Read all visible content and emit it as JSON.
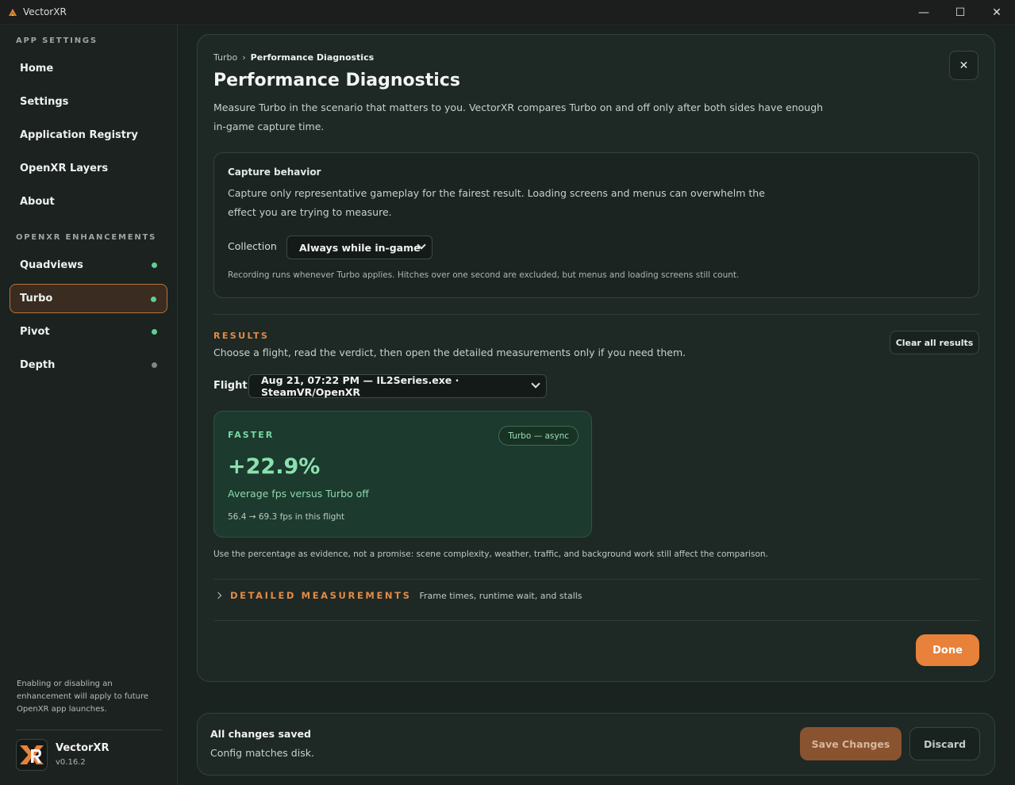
{
  "window": {
    "title": "VectorXR",
    "minimize_glyph": "—",
    "maximize_glyph": "☐",
    "close_glyph": "✕"
  },
  "sidebar": {
    "app_settings_label": "APP SETTINGS",
    "app_items": [
      {
        "label": "Home"
      },
      {
        "label": "Settings"
      },
      {
        "label": "Application Registry"
      },
      {
        "label": "OpenXR Layers"
      },
      {
        "label": "About"
      }
    ],
    "enhancements_label": "OPENXR ENHANCEMENTS",
    "enhancement_items": [
      {
        "label": "Quadviews",
        "status": "enabled"
      },
      {
        "label": "Turbo",
        "status": "enabled",
        "active": true
      },
      {
        "label": "Pivot",
        "status": "enabled"
      },
      {
        "label": "Depth",
        "status": "disabled"
      }
    ],
    "note": "Enabling or disabling an enhancement will apply to future OpenXR app launches.",
    "brand": {
      "name": "VectorXR",
      "version": "v0.16.2"
    }
  },
  "panel": {
    "breadcrumb": {
      "parent": "Turbo",
      "separator": "›",
      "current": "Performance Diagnostics"
    },
    "close_glyph": "✕",
    "title": "Performance Diagnostics",
    "description": "Measure Turbo in the scenario that matters to you. VectorXR compares Turbo on and off only after both sides have enough in-game capture time.",
    "capture": {
      "title": "Capture behavior",
      "description": "Capture only representative gameplay for the fairest result. Loading screens and menus can overwhelm the effect you are trying to measure.",
      "collection_label": "Collection",
      "collection_value": "Always while in-game",
      "note": "Recording runs whenever Turbo applies. Hitches over one second are excluded, but menus and loading screens still count."
    },
    "results": {
      "label": "RESULTS",
      "description": "Choose a flight, read the verdict, then open the detailed measurements only if you need them.",
      "clear_label": "Clear all results",
      "flight_label": "Flight",
      "flight_value": "Aug 21, 07:22 PM — IL2Series.exe · SteamVR/OpenXR",
      "card": {
        "verdict": "FASTER",
        "mode": "Turbo — async",
        "percent": "+22.9%",
        "percent_desc": "Average fps versus Turbo off",
        "fps": "56.4 → 69.3 fps in this flight"
      },
      "evidence_note": "Use the percentage as evidence, not a promise: scene complexity, weather, traffic, and background work still affect the comparison."
    },
    "details": {
      "label": "DETAILED MEASUREMENTS",
      "sublabel": "Frame times, runtime wait, and stalls"
    },
    "done_label": "Done"
  },
  "footer": {
    "title": "All changes saved",
    "subtitle": "Config matches disk.",
    "save_label": "Save Changes",
    "discard_label": "Discard"
  },
  "colors": {
    "accent_orange": "#e8813a",
    "status_green": "#5fcf8f",
    "status_gray": "#7f8683",
    "card_green": "#1c3a2d"
  }
}
